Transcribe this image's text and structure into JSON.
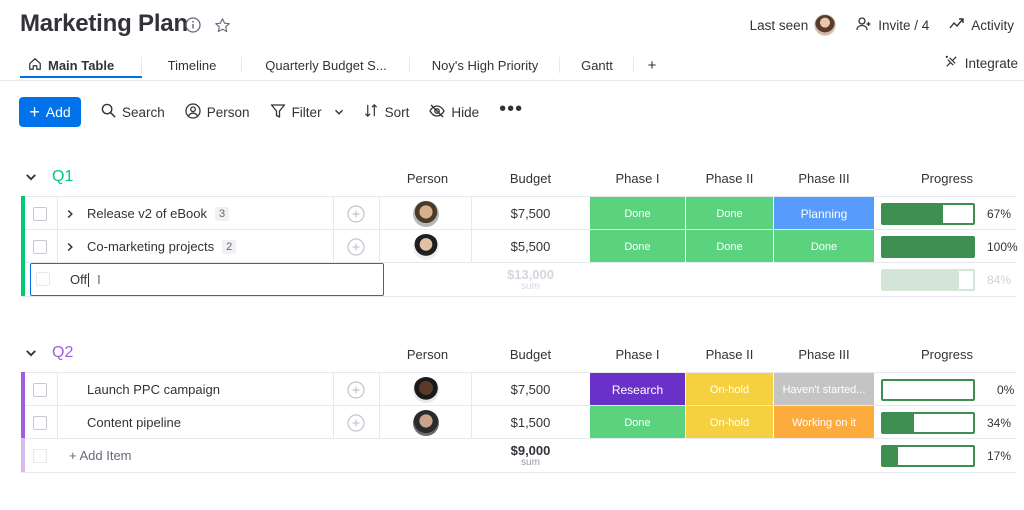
{
  "board": {
    "title": "Marketing Plan"
  },
  "header": {
    "last_seen_label": "Last seen",
    "invite_label": "Invite / 4",
    "activity_label": "Activity"
  },
  "tabs": [
    {
      "label": "Main Table",
      "active": true
    },
    {
      "label": "Timeline"
    },
    {
      "label": "Quarterly Budget S..."
    },
    {
      "label": "Noy's High Priority"
    },
    {
      "label": "Gantt"
    },
    {
      "label": "+"
    }
  ],
  "integrate_label": "Integrate",
  "toolbar": {
    "add_label": "Add",
    "search_label": "Search",
    "person_label": "Person",
    "filter_label": "Filter",
    "sort_label": "Sort",
    "hide_label": "Hide",
    "more_label": "•••"
  },
  "columns": {
    "person": "Person",
    "budget": "Budget",
    "phase1": "Phase I",
    "phase2": "Phase II",
    "phase3": "Phase III",
    "progress": "Progress"
  },
  "colors": {
    "accent": "#0073ea",
    "q1": "#00c875",
    "q2": "#a25ddc",
    "done": "#5bd27d",
    "planning": "#579bfc",
    "research": "#6a31c9",
    "on_hold": "#f5d041",
    "not_started": "#c4c4c4",
    "working_on_it": "#fdab3d",
    "progress_green": "#3f8e51"
  },
  "groups": [
    {
      "title": "Q1",
      "rows": [
        {
          "name": "Release v2 of eBook",
          "subitems": "3",
          "budget": "$7,500",
          "phase1": "Done",
          "phase2": "Done",
          "phase3": "Planning",
          "progress": 0.67,
          "progress_label": "67%"
        },
        {
          "name": "Co-marketing projects",
          "subitems": "2",
          "budget": "$5,500",
          "phase1": "Done",
          "phase2": "Done",
          "phase3": "Done",
          "progress": 1.0,
          "progress_label": "100%"
        }
      ],
      "new_item_value": "Off",
      "summary": {
        "budget": "$13,000",
        "budget_label": "sum",
        "progress": 0.84,
        "progress_label": "84%"
      }
    },
    {
      "title": "Q2",
      "rows": [
        {
          "name": "Launch PPC campaign",
          "budget": "$7,500",
          "phase1": "Research",
          "phase2": "On-hold",
          "phase3": "Haven't started...",
          "progress": 0.0,
          "progress_label": "0%"
        },
        {
          "name": "Content pipeline",
          "budget": "$1,500",
          "phase1": "Done",
          "phase2": "On-hold",
          "phase3": "Working on it",
          "progress": 0.34,
          "progress_label": "34%"
        }
      ],
      "add_item_label": "+ Add Item",
      "summary": {
        "budget": "$9,000",
        "budget_label": "sum",
        "progress": 0.17,
        "progress_label": "17%"
      }
    }
  ]
}
